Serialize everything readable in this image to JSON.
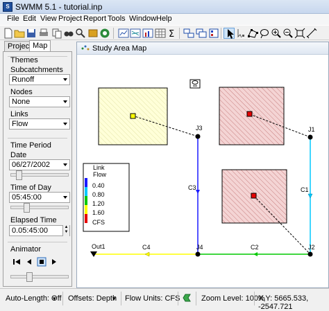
{
  "window": {
    "title": "SWMM 5.1 - tutorial.inp",
    "icon_text": "S"
  },
  "menu": [
    "File",
    "Edit",
    "View",
    "Project",
    "Report",
    "Tools",
    "Window",
    "Help"
  ],
  "toolbar": {
    "icons": [
      "new-icon",
      "open-icon",
      "save-icon",
      "print-icon",
      "copy-icon",
      "find-icon",
      "query-icon",
      "run-icon",
      "profile-plot-icon",
      "time-series-icon",
      "scatter-plot-icon",
      "table-icon",
      "statistics-icon",
      "summation-icon",
      "arrange-windows-icon",
      "cascade-icon",
      "pointer-icon",
      "vertex-icon",
      "polygon-icon",
      "lasso-icon",
      "zoom-in-icon",
      "zoom-out-icon",
      "full-extent-icon",
      "measure-icon"
    ],
    "active": "pointer-icon"
  },
  "panel": {
    "tabs": [
      "Project",
      "Map"
    ],
    "active_tab": "Map",
    "themes_label": "Themes",
    "subcatchments_label": "Subcatchments",
    "subcatchments_value": "Runoff",
    "nodes_label": "Nodes",
    "nodes_value": "None",
    "links_label": "Links",
    "links_value": "Flow",
    "time_period_label": "Time Period",
    "date_label": "Date",
    "date_value": "06/27/2002",
    "time_of_day_label": "Time of Day",
    "time_of_day_value": "05:45:00",
    "elapsed_label": "Elapsed Time",
    "elapsed_value": "0.05:45:00",
    "animator_label": "Animator",
    "date_slider": 0.1,
    "time_slider": 0.25,
    "anim_slider": 0.3
  },
  "map": {
    "title": "Study Area Map",
    "legend": {
      "title": "Link",
      "variable": "Flow",
      "values": [
        "0.40",
        "0.80",
        "1.20",
        "1.60"
      ],
      "unit": "CFS",
      "colors": [
        "#1a1aff",
        "#00c8ff",
        "#00c800",
        "#ffff00",
        "#e60000"
      ]
    },
    "node_labels": [
      "J3",
      "J1",
      "J4",
      "J2",
      "Out1"
    ],
    "link_labels": [
      "C3",
      "C1",
      "C4",
      "C2"
    ],
    "colors": {
      "subcatch_yellow": "#ffffcc",
      "subcatch_red": "#f2c7c7",
      "hatch_red": "#d08080",
      "hatch_yellow": "#e6e6a8"
    }
  },
  "status": {
    "auto_length": "Auto-Length: Off",
    "offsets": "Offsets: Depth",
    "flow_units": "Flow Units: CFS",
    "zoom": "Zoom Level: 100%",
    "xy": "X,Y: 5665.533, -2547.721"
  }
}
